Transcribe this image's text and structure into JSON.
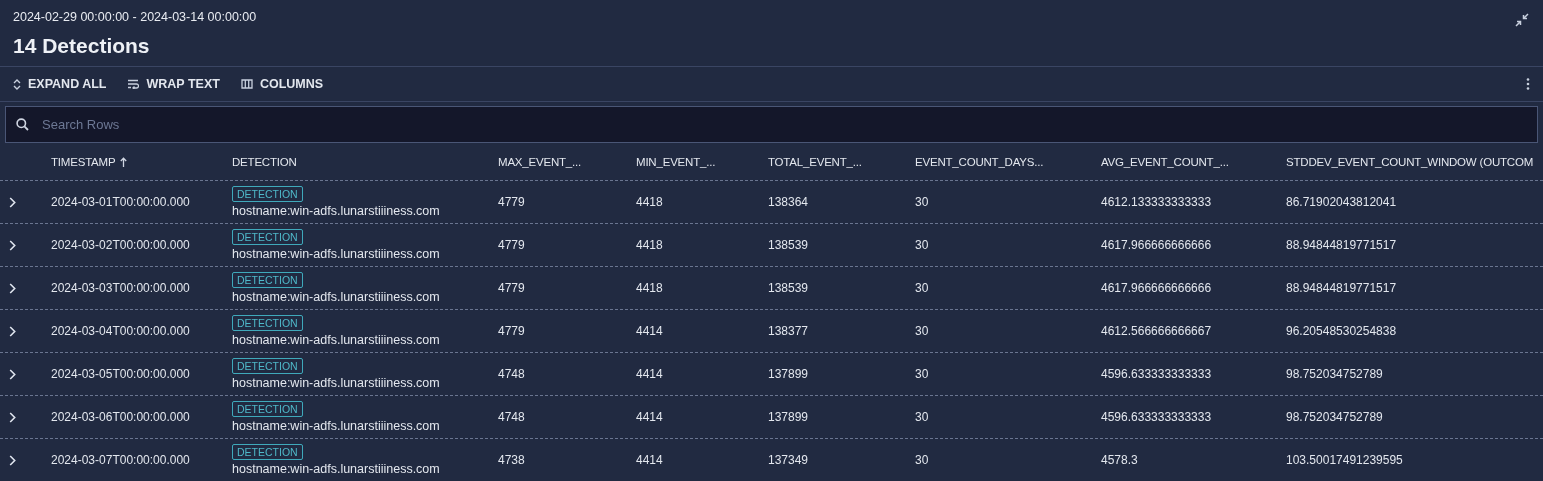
{
  "date_range": "2024-02-29 00:00:00 - 2024-03-14 00:00:00",
  "title": "14 Detections",
  "toolbar": [
    {
      "kind": "expand",
      "label": "EXPAND ALL"
    },
    {
      "kind": "wrap",
      "label": "WRAP TEXT"
    },
    {
      "kind": "columns",
      "label": "COLUMNS"
    }
  ],
  "search": {
    "placeholder": "Search Rows"
  },
  "table": {
    "columns": [
      {
        "label": "TIMESTAMP",
        "sorted": true
      },
      {
        "label": "DETECTION",
        "sorted": false
      },
      {
        "label": "MAX_EVENT_...",
        "sorted": false
      },
      {
        "label": "MIN_EVENT_...",
        "sorted": false
      },
      {
        "label": "TOTAL_EVENT_...",
        "sorted": false
      },
      {
        "label": "EVENT_COUNT_DAYS...",
        "sorted": false
      },
      {
        "label": "AVG_EVENT_COUNT_...",
        "sorted": false
      },
      {
        "label": "STDDEV_EVENT_COUNT_WINDOW (OUTCOM",
        "sorted": false
      }
    ],
    "rows": [
      {
        "expanded": false,
        "timestamp": "2024-03-01T00:00:00.000",
        "tag": "DETECTION",
        "detection": "hostname:win-adfs.lunarstiiiness.com",
        "values": [
          "4779",
          "4418",
          "138364",
          "30",
          "4612.133333333333",
          "86.71902043812041"
        ]
      },
      {
        "expanded": false,
        "timestamp": "2024-03-02T00:00:00.000",
        "tag": "DETECTION",
        "detection": "hostname:win-adfs.lunarstiiiness.com",
        "values": [
          "4779",
          "4418",
          "138539",
          "30",
          "4617.966666666666",
          "88.94844819771517"
        ]
      },
      {
        "expanded": false,
        "timestamp": "2024-03-03T00:00:00.000",
        "tag": "DETECTION",
        "detection": "hostname:win-adfs.lunarstiiiness.com",
        "values": [
          "4779",
          "4418",
          "138539",
          "30",
          "4617.966666666666",
          "88.94844819771517"
        ]
      },
      {
        "expanded": false,
        "timestamp": "2024-03-04T00:00:00.000",
        "tag": "DETECTION",
        "detection": "hostname:win-adfs.lunarstiiiness.com",
        "values": [
          "4779",
          "4414",
          "138377",
          "30",
          "4612.566666666667",
          "96.20548530254838"
        ]
      },
      {
        "expanded": false,
        "timestamp": "2024-03-05T00:00:00.000",
        "tag": "DETECTION",
        "detection": "hostname:win-adfs.lunarstiiiness.com",
        "values": [
          "4748",
          "4414",
          "137899",
          "30",
          "4596.633333333333",
          "98.752034752789"
        ]
      },
      {
        "expanded": false,
        "timestamp": "2024-03-06T00:00:00.000",
        "tag": "DETECTION",
        "detection": "hostname:win-adfs.lunarstiiiness.com",
        "values": [
          "4748",
          "4414",
          "137899",
          "30",
          "4596.633333333333",
          "98.752034752789"
        ]
      },
      {
        "expanded": false,
        "timestamp": "2024-03-07T00:00:00.000",
        "tag": "DETECTION",
        "detection": "hostname:win-adfs.lunarstiiiness.com",
        "values": [
          "4738",
          "4414",
          "137349",
          "30",
          "4578.3",
          "103.50017491239595"
        ]
      }
    ]
  }
}
